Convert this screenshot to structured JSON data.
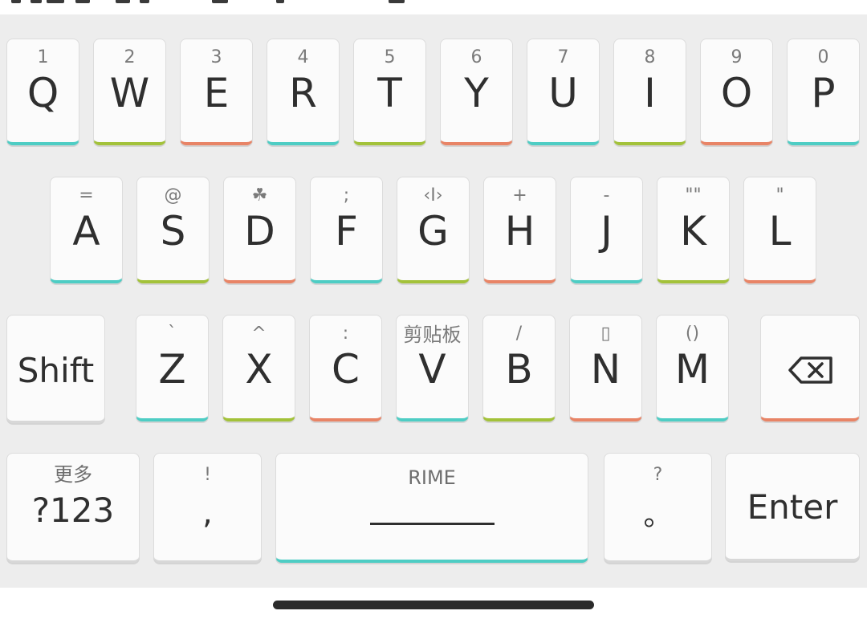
{
  "keyboard": {
    "row1": [
      {
        "hint": "1",
        "label": "Q"
      },
      {
        "hint": "2",
        "label": "W"
      },
      {
        "hint": "3",
        "label": "E"
      },
      {
        "hint": "4",
        "label": "R"
      },
      {
        "hint": "5",
        "label": "T"
      },
      {
        "hint": "6",
        "label": "Y"
      },
      {
        "hint": "7",
        "label": "U"
      },
      {
        "hint": "8",
        "label": "I"
      },
      {
        "hint": "9",
        "label": "O"
      },
      {
        "hint": "0",
        "label": "P"
      }
    ],
    "row2": [
      {
        "hint": "=",
        "label": "A"
      },
      {
        "hint": "@",
        "label": "S"
      },
      {
        "hint": "☘",
        "label": "D"
      },
      {
        "hint": ";",
        "label": "F"
      },
      {
        "hint": "‹I›",
        "label": "G"
      },
      {
        "hint": "+",
        "label": "H"
      },
      {
        "hint": "-",
        "label": "J"
      },
      {
        "hint": "\"\"",
        "label": "K"
      },
      {
        "hint": "\"",
        "label": "L"
      }
    ],
    "row3": [
      {
        "hint": "`",
        "label": "Z"
      },
      {
        "hint": "^",
        "label": "X"
      },
      {
        "hint": ":",
        "label": "C"
      },
      {
        "hint": "剪贴板",
        "label": "V"
      },
      {
        "hint": "/",
        "label": "B"
      },
      {
        "hint": "▯",
        "label": "N"
      },
      {
        "hint": "()",
        "label": "M"
      }
    ],
    "shift_label": "Shift",
    "backspace_icon": "backspace-icon",
    "more_hint": "更多",
    "numbers_label": "?123",
    "comma_hint": "!",
    "comma_label": ",",
    "space_label": "RIME",
    "period_hint": "?",
    "period_label": "。",
    "enter_label": "Enter"
  },
  "colors": {
    "teal": "#4ecdc4",
    "green": "#a3c23a",
    "red": "#e88466",
    "background": "#ededed",
    "key": "#fbfbfb"
  }
}
